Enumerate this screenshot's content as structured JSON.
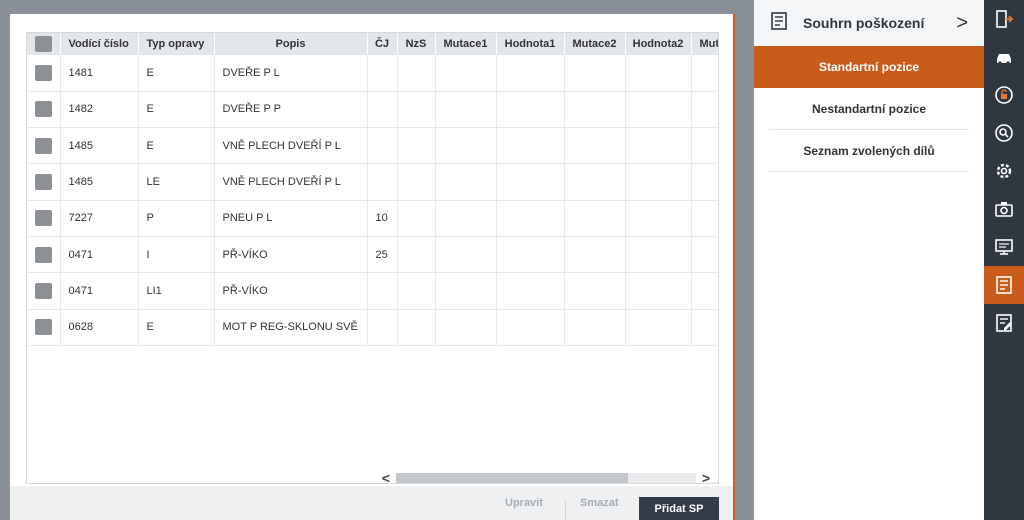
{
  "table": {
    "columns": [
      "",
      "Vodící číslo",
      "Typ opravy",
      "Popis",
      "ČJ",
      "NzS",
      "Mutace1",
      "Hodnota1",
      "Mutace2",
      "Hodnota2",
      "Mut"
    ],
    "rows": [
      {
        "vodici": "1481",
        "typ": "E",
        "popis": "DVEŘE P L",
        "cj": ""
      },
      {
        "vodici": "1482",
        "typ": "E",
        "popis": "DVEŘE P P",
        "cj": ""
      },
      {
        "vodici": "1485",
        "typ": "E",
        "popis": "VNĚ PLECH DVEŘÍ P L",
        "cj": ""
      },
      {
        "vodici": "1485",
        "typ": "LE",
        "popis": "VNĚ PLECH DVEŘÍ P L",
        "cj": ""
      },
      {
        "vodici": "7227",
        "typ": "P",
        "popis": "PNEU P L",
        "cj": "10"
      },
      {
        "vodici": "0471",
        "typ": "I",
        "popis": "PŘ-VÍKO",
        "cj": "25"
      },
      {
        "vodici": "0471",
        "typ": "LI1",
        "popis": "PŘ-VÍKO",
        "cj": ""
      },
      {
        "vodici": "0628",
        "typ": "E",
        "popis": "MOT P REG-SKLONU SVĚ",
        "cj": ""
      }
    ]
  },
  "scrollbar": {
    "left_arrow": "<",
    "right_arrow": ">"
  },
  "footer": {
    "edit_label": "Upravit",
    "delete_label": "Smazat",
    "add_label": "Přidat SP"
  },
  "panel": {
    "title": "Souhrn poškození",
    "chevron": ">",
    "items": [
      {
        "label": "Standartní pozice",
        "active": true
      },
      {
        "label": "Nestandartní pozice",
        "active": false
      },
      {
        "label": "Seznam zvolených dílů",
        "active": false
      }
    ]
  },
  "rail": {
    "icons": [
      "exit-icon",
      "car-icon",
      "lock-icon",
      "search-icon",
      "gear-icon",
      "camera-icon",
      "monitor-icon",
      "damage-summary-icon",
      "edit-list-icon"
    ],
    "active_index": 7
  },
  "colors": {
    "accent": "#c95c1a",
    "rail": "#2f3841",
    "primary_button": "#333d47"
  }
}
